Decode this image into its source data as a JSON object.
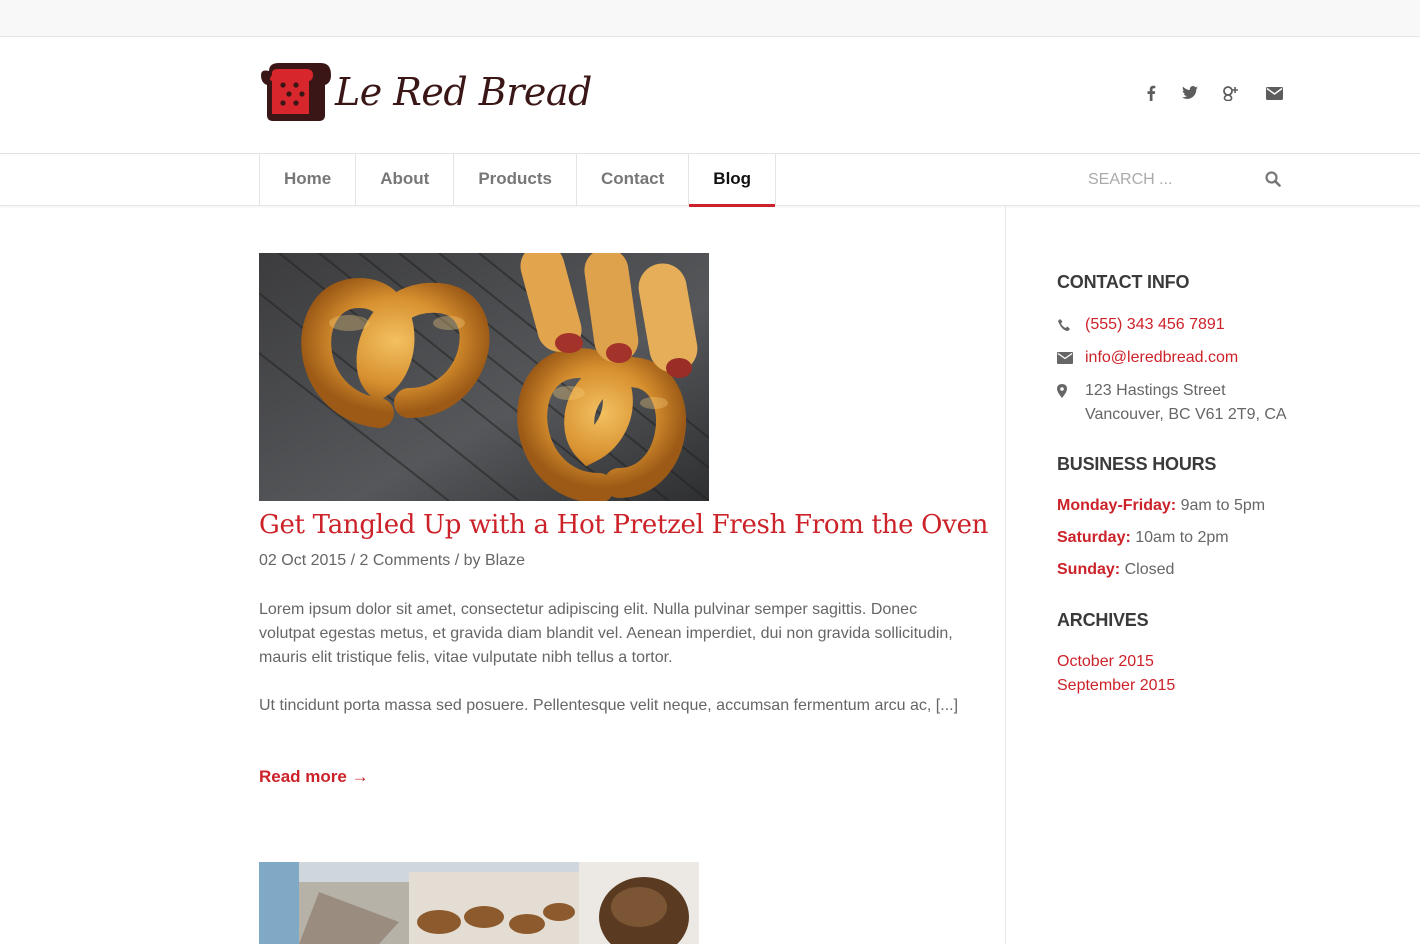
{
  "brand": {
    "name": "Le Red Bread",
    "accent_color": "#cc2229",
    "logo_color": "#3b1616"
  },
  "social": [
    {
      "icon": "facebook-icon"
    },
    {
      "icon": "twitter-icon"
    },
    {
      "icon": "google-plus-icon"
    },
    {
      "icon": "email-icon"
    }
  ],
  "nav": {
    "items": [
      {
        "label": "Home"
      },
      {
        "label": "About"
      },
      {
        "label": "Products"
      },
      {
        "label": "Contact"
      },
      {
        "label": "Blog",
        "active": true
      }
    ],
    "search_placeholder": "SEARCH ..."
  },
  "post": {
    "image_description": "pretzel-photo",
    "title": "Get Tangled Up with a Hot Pretzel Fresh From the Oven",
    "date": "02 Oct 2015",
    "comments": "2 Comments",
    "author_prefix": "by",
    "author": "Blaze",
    "separator": "/",
    "paragraph1": "Lorem ipsum dolor sit amet, consectetur adipiscing elit. Nulla pulvinar semper sagittis. Donec volutpat egestas metus, et gravida diam blandit vel. Aenean imperdiet, dui non gravida sollicitudin, mauris elit tristique felis, vitae vulputate nibh tellus a tortor.",
    "paragraph2": "Ut tincidunt porta massa sed posuere. Pellentesque velit neque, accumsan fermentum arcu ac, [...]",
    "read_more": "Read more →"
  },
  "sidebar": {
    "contact_heading": "CONTACT INFO",
    "phone": "(555) 343 456 7891",
    "email": "info@leredbread.com",
    "address_line1": "123 Hastings Street",
    "address_line2": "Vancouver, BC V61 2T9, CA",
    "hours_heading": "BUSINESS HOURS",
    "hours": [
      {
        "day": "Monday-Friday:",
        "time": "9am to 5pm"
      },
      {
        "day": "Saturday:",
        "time": "10am to 2pm"
      },
      {
        "day": "Sunday:",
        "time": "Closed"
      }
    ],
    "archives_heading": "ARCHIVES",
    "archives": [
      {
        "label": "October 2015"
      },
      {
        "label": "September 2015"
      }
    ]
  }
}
